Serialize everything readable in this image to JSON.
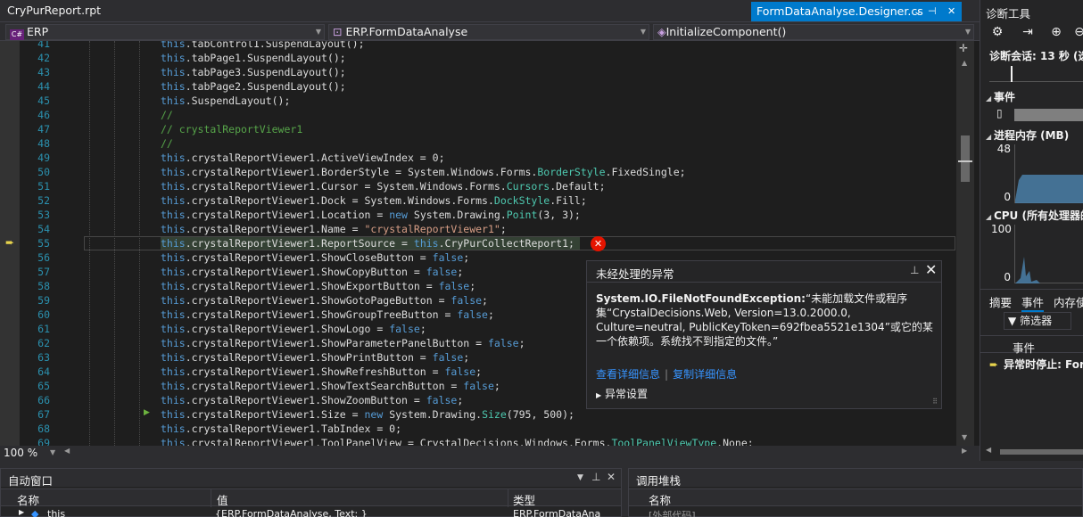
{
  "tabs": {
    "left_file": "CryPurReport.rpt",
    "active_file": "FormDataAnalyse.Designer.cs",
    "active_ctrls": [
      "⌄",
      "⊣",
      "✕"
    ]
  },
  "nav": {
    "project_icon": "C#",
    "project": "ERP",
    "class": "ERP.FormDataAnalyse",
    "member": "InitializeComponent()"
  },
  "code_lines": [
    {
      "n": "41",
      "segs": [
        {
          "c": "kw",
          "t": "this"
        },
        {
          "c": "",
          "t": ".tabControl1.SuspendLayout();"
        }
      ]
    },
    {
      "n": "42",
      "segs": [
        {
          "c": "kw",
          "t": "this"
        },
        {
          "c": "",
          "t": ".tabPage1.SuspendLayout();"
        }
      ]
    },
    {
      "n": "43",
      "segs": [
        {
          "c": "kw",
          "t": "this"
        },
        {
          "c": "",
          "t": ".tabPage3.SuspendLayout();"
        }
      ]
    },
    {
      "n": "44",
      "segs": [
        {
          "c": "kw",
          "t": "this"
        },
        {
          "c": "",
          "t": ".tabPage2.SuspendLayout();"
        }
      ]
    },
    {
      "n": "45",
      "segs": [
        {
          "c": "kw",
          "t": "this"
        },
        {
          "c": "",
          "t": ".SuspendLayout();"
        }
      ]
    },
    {
      "n": "46",
      "segs": [
        {
          "c": "cm",
          "t": "//"
        }
      ]
    },
    {
      "n": "47",
      "segs": [
        {
          "c": "cm",
          "t": "// crystalReportViewer1"
        }
      ]
    },
    {
      "n": "48",
      "segs": [
        {
          "c": "cm",
          "t": "//"
        }
      ]
    },
    {
      "n": "49",
      "segs": [
        {
          "c": "kw",
          "t": "this"
        },
        {
          "c": "",
          "t": ".crystalReportViewer1.ActiveViewIndex = 0;"
        }
      ]
    },
    {
      "n": "50",
      "segs": [
        {
          "c": "kw",
          "t": "this"
        },
        {
          "c": "",
          "t": ".crystalReportViewer1.BorderStyle = System.Windows.Forms."
        },
        {
          "c": "tp",
          "t": "BorderStyle"
        },
        {
          "c": "",
          "t": ".FixedSingle;"
        }
      ]
    },
    {
      "n": "51",
      "segs": [
        {
          "c": "kw",
          "t": "this"
        },
        {
          "c": "",
          "t": ".crystalReportViewer1.Cursor = System.Windows.Forms."
        },
        {
          "c": "tp",
          "t": "Cursors"
        },
        {
          "c": "",
          "t": ".Default;"
        }
      ]
    },
    {
      "n": "52",
      "segs": [
        {
          "c": "kw",
          "t": "this"
        },
        {
          "c": "",
          "t": ".crystalReportViewer1.Dock = System.Windows.Forms."
        },
        {
          "c": "tp",
          "t": "DockStyle"
        },
        {
          "c": "",
          "t": ".Fill;"
        }
      ]
    },
    {
      "n": "53",
      "segs": [
        {
          "c": "kw",
          "t": "this"
        },
        {
          "c": "",
          "t": ".crystalReportViewer1.Location = "
        },
        {
          "c": "kw",
          "t": "new"
        },
        {
          "c": "",
          "t": " System.Drawing."
        },
        {
          "c": "tp",
          "t": "Point"
        },
        {
          "c": "",
          "t": "(3, 3);"
        }
      ]
    },
    {
      "n": "54",
      "segs": [
        {
          "c": "kw",
          "t": "this"
        },
        {
          "c": "",
          "t": ".crystalReportViewer1.Name = "
        },
        {
          "c": "st",
          "t": "\"crystalReportViewer1\""
        },
        {
          "c": "",
          "t": ";"
        }
      ]
    },
    {
      "n": "55",
      "segs": [
        {
          "c": "kw",
          "t": "this"
        },
        {
          "c": "",
          "t": ".crystalReportViewer1.ReportSource = "
        },
        {
          "c": "kw",
          "t": "this"
        },
        {
          "c": "",
          "t": ".CryPurCollectReport1;"
        }
      ]
    },
    {
      "n": "56",
      "segs": [
        {
          "c": "kw",
          "t": "this"
        },
        {
          "c": "",
          "t": ".crystalReportViewer1.ShowCloseButton = "
        },
        {
          "c": "kw",
          "t": "false"
        },
        {
          "c": "",
          "t": ";"
        }
      ]
    },
    {
      "n": "57",
      "segs": [
        {
          "c": "kw",
          "t": "this"
        },
        {
          "c": "",
          "t": ".crystalReportViewer1.ShowCopyButton = "
        },
        {
          "c": "kw",
          "t": "false"
        },
        {
          "c": "",
          "t": ";"
        }
      ]
    },
    {
      "n": "58",
      "segs": [
        {
          "c": "kw",
          "t": "this"
        },
        {
          "c": "",
          "t": ".crystalReportViewer1.ShowExportButton = "
        },
        {
          "c": "kw",
          "t": "false"
        },
        {
          "c": "",
          "t": ";"
        }
      ]
    },
    {
      "n": "59",
      "segs": [
        {
          "c": "kw",
          "t": "this"
        },
        {
          "c": "",
          "t": ".crystalReportViewer1.ShowGotoPageButton = "
        },
        {
          "c": "kw",
          "t": "false"
        },
        {
          "c": "",
          "t": ";"
        }
      ]
    },
    {
      "n": "60",
      "segs": [
        {
          "c": "kw",
          "t": "this"
        },
        {
          "c": "",
          "t": ".crystalReportViewer1.ShowGroupTreeButton = "
        },
        {
          "c": "kw",
          "t": "false"
        },
        {
          "c": "",
          "t": ";"
        }
      ]
    },
    {
      "n": "61",
      "segs": [
        {
          "c": "kw",
          "t": "this"
        },
        {
          "c": "",
          "t": ".crystalReportViewer1.ShowLogo = "
        },
        {
          "c": "kw",
          "t": "false"
        },
        {
          "c": "",
          "t": ";"
        }
      ]
    },
    {
      "n": "62",
      "segs": [
        {
          "c": "kw",
          "t": "this"
        },
        {
          "c": "",
          "t": ".crystalReportViewer1.ShowParameterPanelButton = "
        },
        {
          "c": "kw",
          "t": "false"
        },
        {
          "c": "",
          "t": ";"
        }
      ]
    },
    {
      "n": "63",
      "segs": [
        {
          "c": "kw",
          "t": "this"
        },
        {
          "c": "",
          "t": ".crystalReportViewer1.ShowPrintButton = "
        },
        {
          "c": "kw",
          "t": "false"
        },
        {
          "c": "",
          "t": ";"
        }
      ]
    },
    {
      "n": "64",
      "segs": [
        {
          "c": "kw",
          "t": "this"
        },
        {
          "c": "",
          "t": ".crystalReportViewer1.ShowRefreshButton = "
        },
        {
          "c": "kw",
          "t": "false"
        },
        {
          "c": "",
          "t": ";"
        }
      ]
    },
    {
      "n": "65",
      "segs": [
        {
          "c": "kw",
          "t": "this"
        },
        {
          "c": "",
          "t": ".crystalReportViewer1.ShowTextSearchButton = "
        },
        {
          "c": "kw",
          "t": "false"
        },
        {
          "c": "",
          "t": ";"
        }
      ]
    },
    {
      "n": "66",
      "segs": [
        {
          "c": "kw",
          "t": "this"
        },
        {
          "c": "",
          "t": ".crystalReportViewer1.ShowZoomButton = "
        },
        {
          "c": "kw",
          "t": "false"
        },
        {
          "c": "",
          "t": ";"
        }
      ]
    },
    {
      "n": "67",
      "segs": [
        {
          "c": "kw",
          "t": "this"
        },
        {
          "c": "",
          "t": ".crystalReportViewer1.Size = "
        },
        {
          "c": "kw",
          "t": "new"
        },
        {
          "c": "",
          "t": " System.Drawing."
        },
        {
          "c": "tp",
          "t": "Size"
        },
        {
          "c": "",
          "t": "(795, 500);"
        }
      ]
    },
    {
      "n": "68",
      "segs": [
        {
          "c": "kw",
          "t": "this"
        },
        {
          "c": "",
          "t": ".crystalReportViewer1.TabIndex = 0;"
        }
      ]
    },
    {
      "n": "69",
      "segs": [
        {
          "c": "kw",
          "t": "this"
        },
        {
          "c": "",
          "t": ".crystalReportViewer1.ToolPanelView = CrystalDecisions.Windows.Forms."
        },
        {
          "c": "tp",
          "t": "ToolPanelViewType"
        },
        {
          "c": "",
          "t": ".None;"
        }
      ]
    }
  ],
  "current_line": "55",
  "exception": {
    "title": "未经处理的异常",
    "type": "System.IO.FileNotFoundException:",
    "message": "“未能加载文件或程序集“CrystalDecisions.Web, Version=13.0.2000.0, Culture=neutral, PublicKeyToken=692fbea5521e1304”或它的某一个依赖项。系统找不到指定的文件。”",
    "link_details": "查看详细信息",
    "link_copy": "复制详细信息",
    "settings": "异常设置"
  },
  "zoom": "100 %",
  "autos": {
    "title": "自动窗口",
    "col_name": "名称",
    "col_value": "值",
    "col_type": "类型",
    "row_name": "this",
    "row_value": "{ERP.FormDataAnalyse, Text: }",
    "row_type": "ERP.FormDataAna"
  },
  "callstack": {
    "title": "调用堆栈",
    "col_name": "名称",
    "row": "[外部代码]"
  },
  "diag": {
    "title": "诊断工具",
    "session": "诊断会话: 13 秒 (选",
    "events": "事件",
    "memory": "进程内存 (MB)",
    "mem_max": "48",
    "mem_min": "0",
    "cpu": "CPU (所有处理器的",
    "cpu_max": "100",
    "cpu_min": "0",
    "tab_summary": "摘要",
    "tab_events": "事件",
    "tab_memory": "内存使",
    "filter": "筛选器",
    "col_event": "事件",
    "row_event": "异常时停止: For"
  },
  "colors": {
    "accent": "#007acc",
    "error": "#e51400",
    "chart_fill": "#4a7fa8"
  }
}
